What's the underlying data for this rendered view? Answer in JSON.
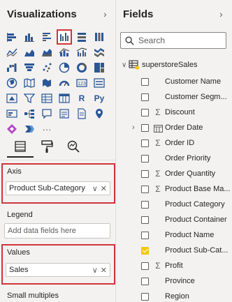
{
  "visualizations": {
    "title": "Visualizations",
    "tools": [
      {
        "icon": "fields-icon"
      },
      {
        "icon": "paint-roller-icon"
      },
      {
        "icon": "analytics-magnifier-icon"
      }
    ],
    "wells": {
      "axis": {
        "label": "Axis",
        "value": "Product Sub-Category"
      },
      "legend": {
        "label": "Legend",
        "placeholder": "Add data fields here"
      },
      "values": {
        "label": "Values",
        "value": "Sales"
      },
      "small_multiples": {
        "label": "Small multiples"
      }
    },
    "r_label": "R",
    "py_label": "Py",
    "more_label": "···"
  },
  "fields": {
    "title": "Fields",
    "search_placeholder": "Search",
    "table_name": "superstoreSales",
    "items": [
      {
        "name": "Customer Name",
        "type": "",
        "checked": false,
        "expand": false
      },
      {
        "name": "Customer Segm...",
        "type": "",
        "checked": false,
        "expand": false
      },
      {
        "name": "Discount",
        "type": "sum",
        "checked": false,
        "expand": false
      },
      {
        "name": "Order Date",
        "type": "date",
        "checked": false,
        "expand": true
      },
      {
        "name": "Order ID",
        "type": "sum",
        "checked": false,
        "expand": false
      },
      {
        "name": "Order Priority",
        "type": "",
        "checked": false,
        "expand": false
      },
      {
        "name": "Order Quantity",
        "type": "sum",
        "checked": false,
        "expand": false
      },
      {
        "name": "Product Base Ma...",
        "type": "sum",
        "checked": false,
        "expand": false
      },
      {
        "name": "Product Category",
        "type": "",
        "checked": false,
        "expand": false
      },
      {
        "name": "Product Container",
        "type": "",
        "checked": false,
        "expand": false
      },
      {
        "name": "Product Name",
        "type": "",
        "checked": false,
        "expand": false
      },
      {
        "name": "Product Sub-Cat...",
        "type": "",
        "checked": true,
        "expand": false
      },
      {
        "name": "Profit",
        "type": "sum",
        "checked": false,
        "expand": false
      },
      {
        "name": "Province",
        "type": "",
        "checked": false,
        "expand": false
      },
      {
        "name": "Region",
        "type": "",
        "checked": false,
        "expand": false
      }
    ]
  },
  "colors": {
    "accent": "#f2c811",
    "highlight": "#d13438",
    "icon_blue": "#2b5797"
  }
}
